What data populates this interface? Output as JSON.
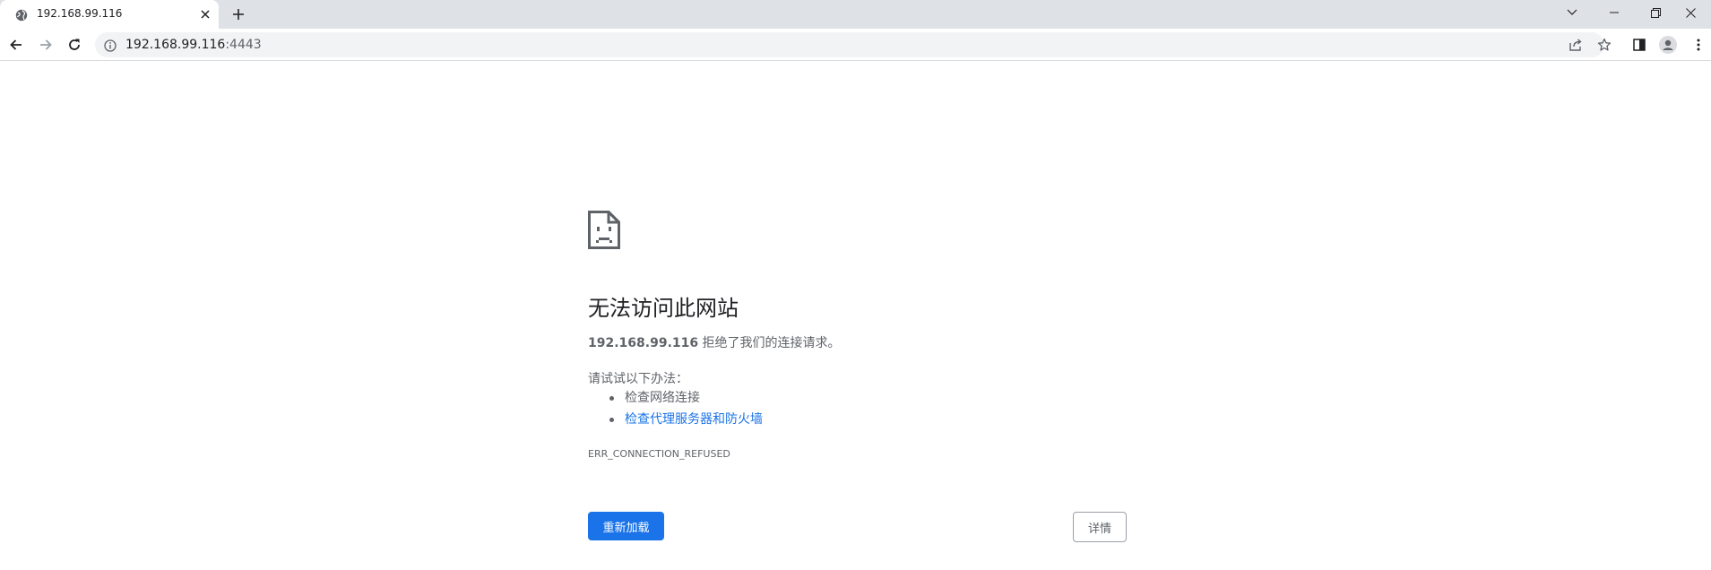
{
  "browser": {
    "tab": {
      "title": "192.168.99.116",
      "favicon": "globe-icon"
    },
    "address": {
      "host": "192.168.99.116",
      "port": ":4443"
    },
    "colors": {
      "tabstrip_bg": "#dee1e6",
      "omnibox_bg": "#f1f3f4",
      "accent": "#1a73e8"
    }
  },
  "error_page": {
    "icon": "sad-document-icon",
    "title": "无法访问此网站",
    "host": "192.168.99.116",
    "description_suffix": " 拒绝了我们的连接请求。",
    "try_label": "请试试以下办法：",
    "suggestions": [
      {
        "text": "检查网络连接",
        "is_link": false
      },
      {
        "text": "检查代理服务器和防火墙",
        "is_link": true
      }
    ],
    "error_code": "ERR_CONNECTION_REFUSED",
    "reload_button": "重新加载",
    "details_button": "详情"
  }
}
